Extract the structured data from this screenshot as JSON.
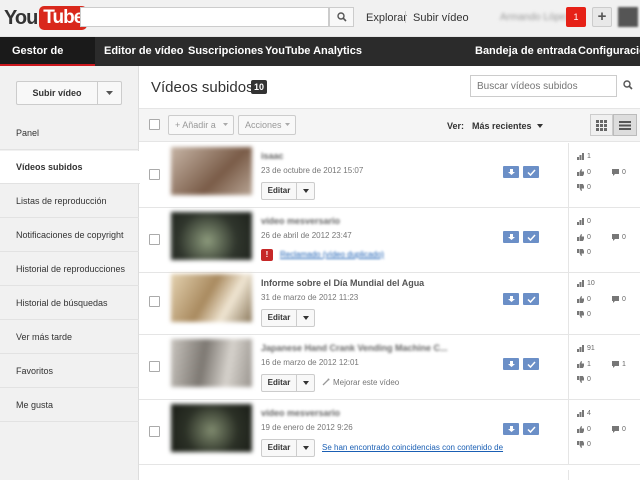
{
  "header": {
    "logo_you": "You",
    "logo_tube": "Tube",
    "search_placeholder": "",
    "explore": "Explorar",
    "upload": "Subir vídeo",
    "user_name": "Armando López",
    "notification_count": "1"
  },
  "nav": {
    "items": [
      "Gestor de vídeos",
      "Editor de vídeo",
      "Suscripciones",
      "YouTube Analytics",
      "Bandeja de entrada",
      "Configuración"
    ]
  },
  "sidebar": {
    "upload_button": "Subir vídeo",
    "items": [
      "Panel",
      "Vídeos subidos",
      "Listas de reproducción",
      "Notificaciones de copyright",
      "Historial de reproducciones",
      "Historial de búsquedas",
      "Ver más tarde",
      "Favoritos",
      "Me gusta"
    ]
  },
  "main": {
    "title": "Vídeos subidos",
    "count": "10",
    "search_placeholder": "Buscar vídeos subidos"
  },
  "toolbar": {
    "add_to": "+ Añadir a",
    "actions": "Acciones",
    "view_label": "Ver:",
    "sort": "Más recientes"
  },
  "videos": [
    {
      "title": "isaac",
      "date": "23 de octubre de 2012 15:07",
      "edit": "Editar",
      "extra": "",
      "views": "1",
      "likes": "0",
      "dislikes": "0",
      "comments": "0",
      "thumb_color": "#8a6a55"
    },
    {
      "title": "vídeo mesversario",
      "date": "26 de abril de 2012 23:47",
      "edit": "",
      "extra": "Reclamado (vídeo duplicado)",
      "views": "0",
      "likes": "0",
      "dislikes": "0",
      "comments": "0",
      "thumb_color": "#3a3f38"
    },
    {
      "title": "Informe sobre el Día Mundial del Agua",
      "date": "31 de marzo de 2012 11:23",
      "edit": "Editar",
      "extra": "",
      "views": "10",
      "likes": "0",
      "dislikes": "0",
      "comments": "0",
      "thumb_color": "#b9a27e"
    },
    {
      "title": "Japanese Hand Crank Vending Machine C...",
      "date": "16 de marzo de 2012 12:01",
      "edit": "Editar",
      "extra": "Mejorar este vídeo",
      "views": "91",
      "likes": "1",
      "dislikes": "0",
      "comments": "1",
      "thumb_color": "#9a9590"
    },
    {
      "title": "vídeo mesversario",
      "date": "19 de enero de 2012 9:26",
      "edit": "Editar",
      "extra": "Se han encontrado coincidencias con contenido de",
      "views": "4",
      "likes": "0",
      "dislikes": "0",
      "comments": "0",
      "thumb_color": "#35392f"
    }
  ],
  "colors": {
    "brand_red": "#d9281c",
    "nav_bg": "#2b2b2b",
    "action_blue": "#6b8fc7",
    "link_blue": "#1a5fb4"
  }
}
